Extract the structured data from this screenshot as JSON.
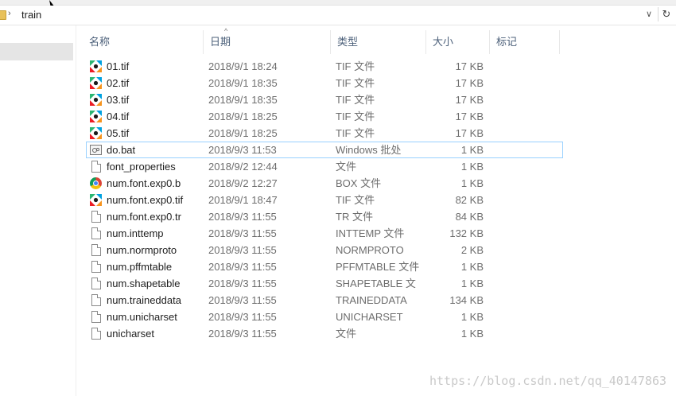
{
  "address": {
    "crumb_separator": "›",
    "folder": "train",
    "dropdown_glyph": "∨",
    "refresh_glyph": "↻"
  },
  "columns": {
    "name": "名称",
    "date": "日期",
    "type": "类型",
    "size": "大小",
    "tags": "标记",
    "sort_indicator": "^"
  },
  "files": [
    {
      "name": "01.tif",
      "date": "2018/9/1 18:24",
      "type": "TIF 文件",
      "size": "17 KB",
      "icon": "tif-image-icon"
    },
    {
      "name": "02.tif",
      "date": "2018/9/1 18:35",
      "type": "TIF 文件",
      "size": "17 KB",
      "icon": "tif-image-icon"
    },
    {
      "name": "03.tif",
      "date": "2018/9/1 18:35",
      "type": "TIF 文件",
      "size": "17 KB",
      "icon": "tif-image-icon"
    },
    {
      "name": "04.tif",
      "date": "2018/9/1 18:25",
      "type": "TIF 文件",
      "size": "17 KB",
      "icon": "tif-image-icon"
    },
    {
      "name": "05.tif",
      "date": "2018/9/1 18:25",
      "type": "TIF 文件",
      "size": "17 KB",
      "icon": "tif-image-icon"
    },
    {
      "name": "do.bat",
      "date": "2018/9/3 11:53",
      "type": "Windows 批处",
      "size": "1 KB",
      "icon": "batch-file-icon"
    },
    {
      "name": "font_properties",
      "date": "2018/9/2 12:44",
      "type": "文件",
      "size": "1 KB",
      "icon": "generic-file-icon"
    },
    {
      "name": "num.font.exp0.b",
      "date": "2018/9/2 12:27",
      "type": "BOX 文件",
      "size": "1 KB",
      "icon": "chrome-icon"
    },
    {
      "name": "num.font.exp0.tif",
      "date": "2018/9/1 18:47",
      "type": "TIF 文件",
      "size": "82 KB",
      "icon": "tif-image-icon"
    },
    {
      "name": "num.font.exp0.tr",
      "date": "2018/9/3 11:55",
      "type": "TR 文件",
      "size": "84 KB",
      "icon": "generic-file-icon"
    },
    {
      "name": "num.inttemp",
      "date": "2018/9/3 11:55",
      "type": "INTTEMP 文件",
      "size": "132 KB",
      "icon": "generic-file-icon"
    },
    {
      "name": "num.normproto",
      "date": "2018/9/3 11:55",
      "type": "NORMPROTO",
      "size": "2 KB",
      "icon": "generic-file-icon"
    },
    {
      "name": "num.pffmtable",
      "date": "2018/9/3 11:55",
      "type": "PFFMTABLE 文件",
      "size": "1 KB",
      "icon": "generic-file-icon"
    },
    {
      "name": "num.shapetable",
      "date": "2018/9/3 11:55",
      "type": "SHAPETABLE 文",
      "size": "1 KB",
      "icon": "generic-file-icon"
    },
    {
      "name": "num.traineddata",
      "date": "2018/9/3 11:55",
      "type": "TRAINEDDATA",
      "size": "134 KB",
      "icon": "generic-file-icon"
    },
    {
      "name": "num.unicharset",
      "date": "2018/9/3 11:55",
      "type": "UNICHARSET",
      "size": "1 KB",
      "icon": "generic-file-icon"
    },
    {
      "name": "unicharset",
      "date": "2018/9/3 11:55",
      "type": "文件",
      "size": "1 KB",
      "icon": "generic-file-icon"
    }
  ],
  "watermark": "https://blog.csdn.net/qq_40147863"
}
